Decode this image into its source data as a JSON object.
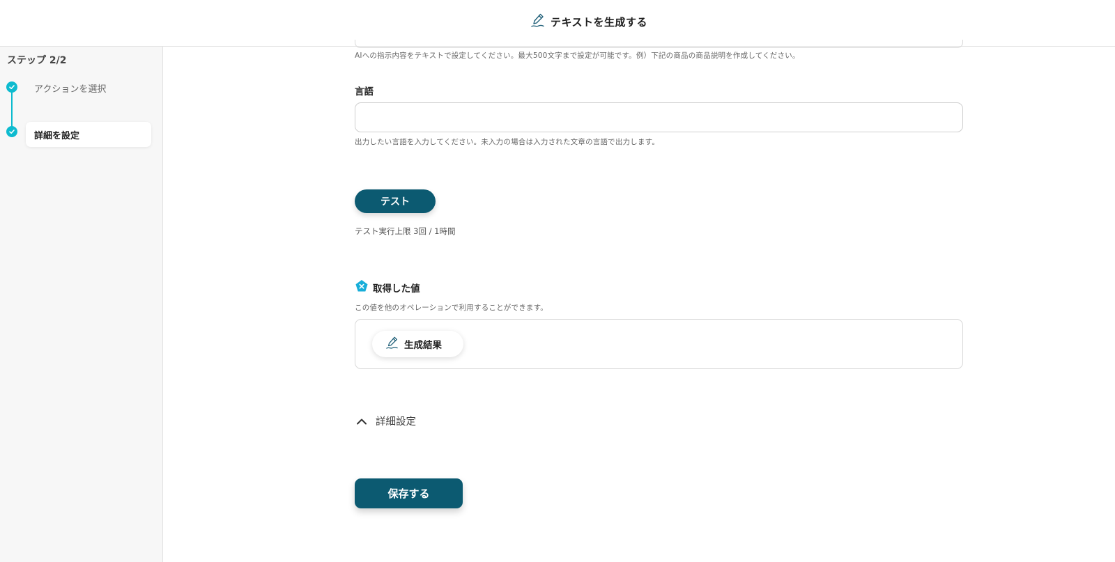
{
  "header": {
    "title": "テキストを生成する",
    "icon": "pen-icon"
  },
  "sidebar": {
    "step_label": "ステップ 2/2",
    "steps": [
      {
        "label": "アクションを選択",
        "status": "done"
      },
      {
        "label": "詳細を設定",
        "status": "current"
      }
    ]
  },
  "form": {
    "prompt_hint": "AIへの指示内容をテキストで設定してください。最大500文字まで設定が可能です。例）下記の商品の商品説明を作成してください。",
    "language": {
      "label": "言語",
      "value": "",
      "hint": "出力したい言語を入力してください。未入力の場合は入力された文章の言語で出力します。"
    },
    "test_button": "テスト",
    "test_limit": "テスト実行上限 3回 / 1時間",
    "outputs": {
      "label": "取得した値",
      "hint": "この値を他のオペレーションで利用することができます。",
      "items": [
        "生成結果"
      ]
    },
    "advanced_label": "詳細設定",
    "save_button": "保存する"
  },
  "colors": {
    "accent": "#0dbbcf",
    "primary_button": "#0c5a71"
  }
}
